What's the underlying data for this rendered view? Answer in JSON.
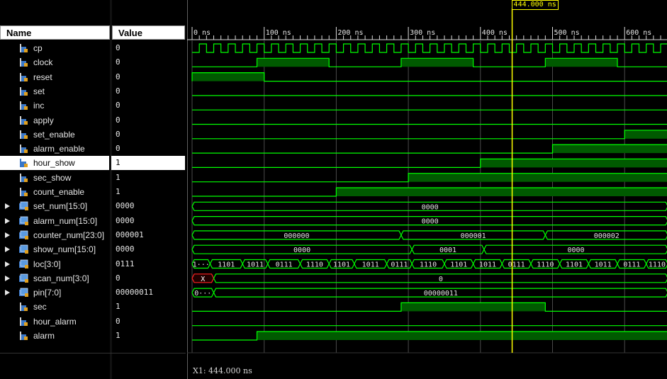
{
  "columns": {
    "name": "Name",
    "value": "Value"
  },
  "cursor": {
    "label": "444.000 ns",
    "time": 444
  },
  "footer": {
    "text": "X1: 444.000 ns"
  },
  "timeline": {
    "range_ns": [
      0,
      660
    ],
    "ticks": [
      {
        "t": 0,
        "label": "0 ns"
      },
      {
        "t": 100,
        "label": "100 ns"
      },
      {
        "t": 200,
        "label": "200 ns"
      },
      {
        "t": 300,
        "label": "300 ns"
      },
      {
        "t": 400,
        "label": "400 ns"
      },
      {
        "t": 500,
        "label": "500 ns"
      },
      {
        "t": 600,
        "label": "600 ns"
      }
    ]
  },
  "signals": [
    {
      "name": "cp",
      "value": "0",
      "type": "bit",
      "clock_period": 20
    },
    {
      "name": "clock",
      "value": "0",
      "type": "bit",
      "highs": [
        [
          90,
          190
        ],
        [
          290,
          390
        ],
        [
          490,
          590
        ]
      ]
    },
    {
      "name": "reset",
      "value": "0",
      "type": "bit",
      "highs": [
        [
          0,
          100
        ]
      ]
    },
    {
      "name": "set",
      "value": "0",
      "type": "bit",
      "highs": []
    },
    {
      "name": "inc",
      "value": "0",
      "type": "bit",
      "highs": []
    },
    {
      "name": "apply",
      "value": "0",
      "type": "bit",
      "highs": []
    },
    {
      "name": "set_enable",
      "value": "0",
      "type": "bit",
      "highs": [
        [
          600,
          660
        ]
      ]
    },
    {
      "name": "alarm_enable",
      "value": "0",
      "type": "bit",
      "highs": [
        [
          500,
          660
        ]
      ]
    },
    {
      "name": "hour_show",
      "value": "1",
      "type": "bit",
      "selected": true,
      "highs": [
        [
          400,
          660
        ]
      ]
    },
    {
      "name": "sec_show",
      "value": "1",
      "type": "bit",
      "highs": [
        [
          300,
          660
        ]
      ]
    },
    {
      "name": "count_enable",
      "value": "1",
      "type": "bit",
      "highs": [
        [
          200,
          660
        ]
      ]
    },
    {
      "name": "set_num[15:0]",
      "value": "0000",
      "type": "bus",
      "segs": [
        {
          "s": 0,
          "e": 660,
          "label": "0000"
        }
      ]
    },
    {
      "name": "alarm_num[15:0]",
      "value": "0000",
      "type": "bus",
      "segs": [
        {
          "s": 0,
          "e": 660,
          "label": "0000"
        }
      ]
    },
    {
      "name": "counter_num[23:0]",
      "value": "000001",
      "type": "bus",
      "segs": [
        {
          "s": 0,
          "e": 290,
          "label": "000000"
        },
        {
          "s": 290,
          "e": 490,
          "label": "000001"
        },
        {
          "s": 490,
          "e": 660,
          "label": "000002"
        }
      ]
    },
    {
      "name": "show_num[15:0]",
      "value": "0000",
      "type": "bus",
      "segs": [
        {
          "s": 0,
          "e": 305,
          "label": "0000"
        },
        {
          "s": 305,
          "e": 405,
          "label": "0001"
        },
        {
          "s": 405,
          "e": 660,
          "label": "0000"
        }
      ]
    },
    {
      "name": "loc[3:0]",
      "value": "0111",
      "type": "bus",
      "segs": [
        {
          "s": 0,
          "e": 25,
          "label": "1···"
        },
        {
          "s": 25,
          "e": 70,
          "label": "1101"
        },
        {
          "s": 70,
          "e": 105,
          "label": "1011"
        },
        {
          "s": 105,
          "e": 150,
          "label": "0111"
        },
        {
          "s": 150,
          "e": 190,
          "label": "1110"
        },
        {
          "s": 190,
          "e": 225,
          "label": "1101"
        },
        {
          "s": 225,
          "e": 270,
          "label": "1011"
        },
        {
          "s": 270,
          "e": 305,
          "label": "0111"
        },
        {
          "s": 305,
          "e": 350,
          "label": "1110"
        },
        {
          "s": 350,
          "e": 390,
          "label": "1101"
        },
        {
          "s": 390,
          "e": 430,
          "label": "1011"
        },
        {
          "s": 430,
          "e": 470,
          "label": "0111"
        },
        {
          "s": 470,
          "e": 510,
          "label": "1110"
        },
        {
          "s": 510,
          "e": 550,
          "label": "1101"
        },
        {
          "s": 550,
          "e": 590,
          "label": "1011"
        },
        {
          "s": 590,
          "e": 630,
          "label": "0111"
        },
        {
          "s": 630,
          "e": 660,
          "label": "1110"
        }
      ]
    },
    {
      "name": "scan_num[3:0]",
      "value": "0",
      "type": "bus",
      "segs": [
        {
          "s": 0,
          "e": 30,
          "label": "X",
          "err": true
        },
        {
          "s": 30,
          "e": 660,
          "label": "0"
        }
      ]
    },
    {
      "name": "pin[7:0]",
      "value": "00000011",
      "type": "bus",
      "segs": [
        {
          "s": 0,
          "e": 30,
          "label": "0···"
        },
        {
          "s": 30,
          "e": 660,
          "label": "00000011"
        }
      ]
    },
    {
      "name": "sec",
      "value": "1",
      "type": "bit",
      "highs": [
        [
          290,
          490
        ]
      ]
    },
    {
      "name": "hour_alarm",
      "value": "0",
      "type": "bit",
      "highs": []
    },
    {
      "name": "alarm",
      "value": "1",
      "type": "bit",
      "highs": [
        [
          90,
          660
        ]
      ]
    }
  ],
  "colors": {
    "wave": "#00ff00",
    "wave_fill": "#005a00",
    "grid": "#4a4a4a",
    "cursor": "#ffff00",
    "bus_error": "#ff2020",
    "text": "#e6e6e6"
  }
}
